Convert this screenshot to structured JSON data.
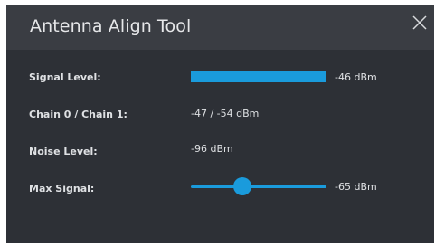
{
  "dialog": {
    "title": "Antenna Align Tool",
    "close_icon": "close-icon"
  },
  "rows": {
    "signal_level": {
      "label": "Signal Level:",
      "value": "-46 dBm",
      "bar_fill_fraction": 1.0
    },
    "chain": {
      "label": "Chain 0 / Chain 1:",
      "value": "-47 / -54 dBm"
    },
    "noise_level": {
      "label": "Noise Level:",
      "value": "-96 dBm"
    },
    "max_signal": {
      "label": "Max Signal:",
      "value": "-65 dBm",
      "slider_fraction": 0.38
    }
  },
  "colors": {
    "background": "#2d3036",
    "titlebar": "#3a3d43",
    "accent": "#1a9bdc",
    "text": "#dfe1e4"
  }
}
